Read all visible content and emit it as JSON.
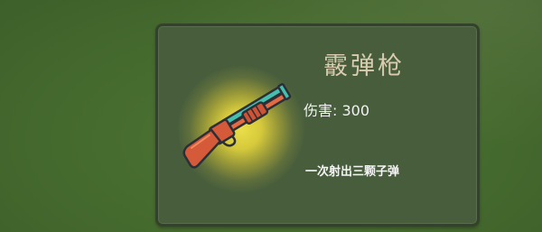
{
  "item": {
    "name": "霰弹枪",
    "damage_label": "伤害: 300",
    "description": "一次射出三颗子弹",
    "icon": "shotgun-icon"
  },
  "colors": {
    "background": "#456a2e",
    "card": "#475d3c",
    "card_border": "#33432b",
    "title": "#d8cbb0",
    "glow": "#eade4a",
    "gun_body": "#d55a3a",
    "gun_barrel": "#45bfae"
  }
}
